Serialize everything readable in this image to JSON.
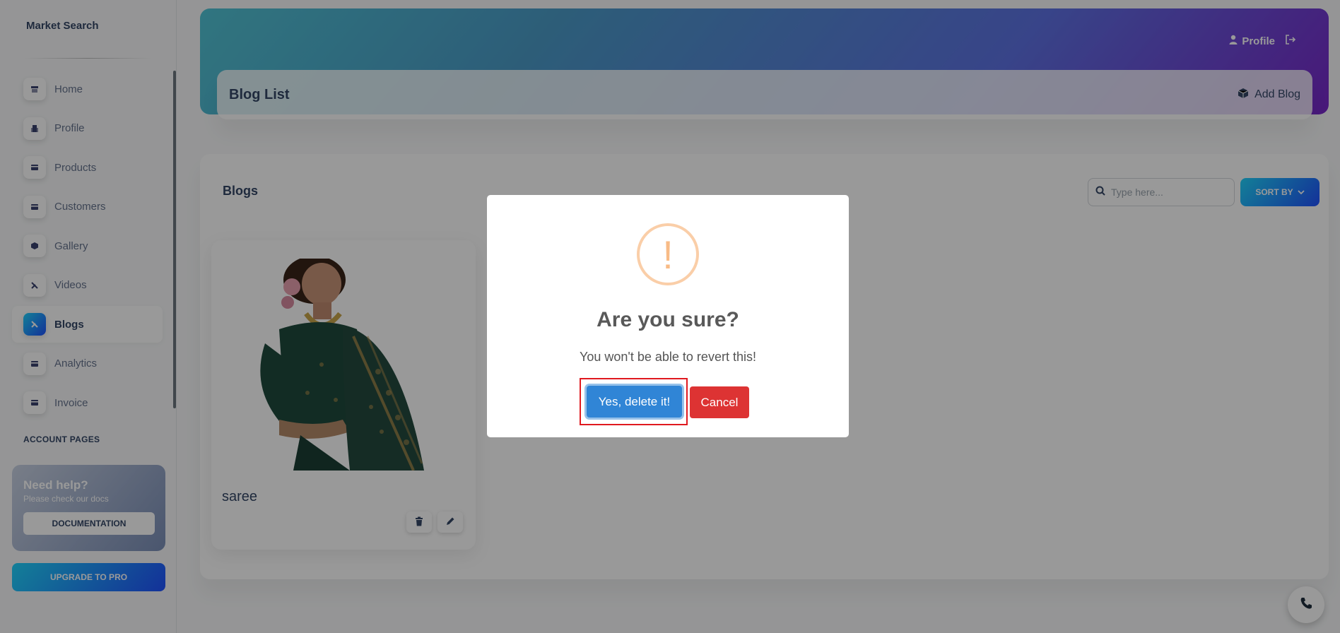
{
  "sidebar": {
    "brand": "Market Search",
    "items": [
      {
        "label": "Home",
        "icon": "shop-icon"
      },
      {
        "label": "Profile",
        "icon": "office-icon"
      },
      {
        "label": "Products",
        "icon": "credit-card-icon"
      },
      {
        "label": "Customers",
        "icon": "credit-card-icon"
      },
      {
        "label": "Gallery",
        "icon": "box-icon"
      },
      {
        "label": "Videos",
        "icon": "tools-icon"
      },
      {
        "label": "Blogs",
        "icon": "tools-icon",
        "active": true
      },
      {
        "label": "Analytics",
        "icon": "credit-card-icon"
      },
      {
        "label": "Invoice",
        "icon": "credit-card-icon"
      }
    ],
    "section_title": "ACCOUNT PAGES",
    "help": {
      "title": "Need help?",
      "subtitle": "Please check our docs",
      "button": "DOCUMENTATION"
    },
    "upgrade_button": "UPGRADE TO PRO"
  },
  "header": {
    "profile_label": "Profile",
    "page_title": "Blog List",
    "add_blog_label": "Add Blog"
  },
  "main": {
    "section_title": "Blogs",
    "search_placeholder": "Type here...",
    "sort_label": "SORT BY",
    "blogs": [
      {
        "name": "saree"
      }
    ]
  },
  "modal": {
    "title": "Are you sure?",
    "text": "You won't be able to revert this!",
    "confirm_label": "Yes, delete it!",
    "cancel_label": "Cancel",
    "warning_glyph": "!"
  },
  "colors": {
    "accent_gradient_start": "#2152ff",
    "accent_gradient_end": "#21d4fd",
    "confirm": "#3085d6",
    "cancel": "#dd3333",
    "warning": "#f8bb86"
  }
}
